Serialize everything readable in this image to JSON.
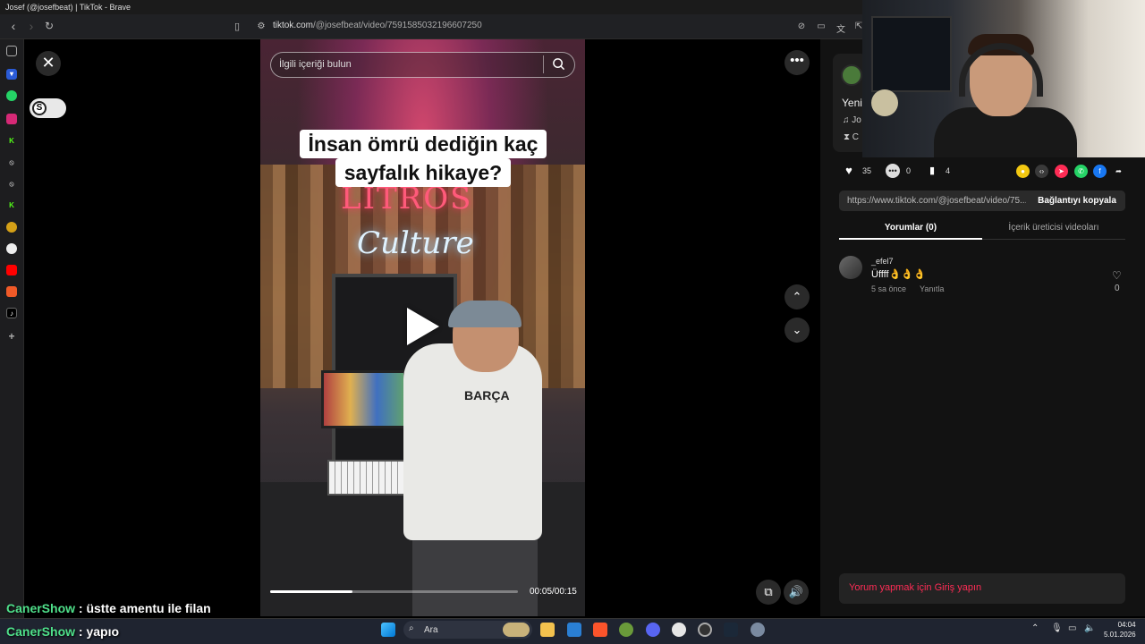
{
  "window": {
    "title": "Josef (@josefbeat) | TikTok - Brave"
  },
  "browser": {
    "url_domain": "tiktok.com",
    "url_path": "/@josefbeat/video/7591585032196607250"
  },
  "video": {
    "search_placeholder": "İlgili içeriği bulun",
    "caption_line1": "İnsan ömrü dediğin kaç",
    "caption_line2": "sayfalık hikaye?",
    "neon_top": "LITROS",
    "neon_bottom": "Culture",
    "shirt_text": "BARÇA",
    "time": "00:05/00:15",
    "progress": 0.333
  },
  "creator": {
    "heading": "Yeni",
    "music_row": "♫ Jo",
    "c_row": "⧗ C"
  },
  "actions": {
    "likes": "35",
    "comments": "0",
    "saves": "4"
  },
  "copy_link": {
    "url": "https://www.tiktok.com/@josefbeat/video/75...",
    "button": "Bağlantıyı kopyala"
  },
  "tabs": {
    "comments": "Yorumlar (0)",
    "creator_videos": "İçerik üreticisi videoları"
  },
  "comment": {
    "user": "_efel7",
    "text": "Üffff👌👌👌",
    "time": "5 sa önce",
    "reply": "Yanıtla",
    "likes": "0"
  },
  "login_prompt": "Yorum yapmak için Giriş yapın",
  "chat": [
    {
      "name": "CanerShow",
      "message": " : üstte amentu ile filan"
    },
    {
      "name": "CanerShow",
      "message": " : yapıo"
    }
  ],
  "taskbar": {
    "search_label": "Ara",
    "time": "04:04",
    "date": "5.01.2026"
  },
  "colors": {
    "tiktok_red": "#fe2c55",
    "chat_name": "#4fe08a"
  }
}
